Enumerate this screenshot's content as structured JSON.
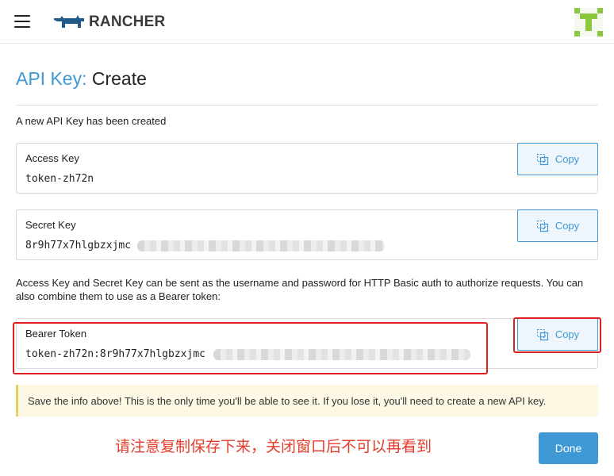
{
  "header": {
    "logo_text": "RANCHER",
    "brand_color": "#1f5a8a",
    "accent_color": "#3d98d3"
  },
  "page": {
    "title_prefix": "API Key:",
    "title_suffix": "Create",
    "notice": "A new API Key has been created",
    "explain": "Access Key and Secret Key can be sent as the username and password for HTTP Basic auth to authorize requests. You can also combine them to use as a Bearer token:",
    "warning": "Save the info above! This is the only time you'll be able to see it. If you lose it, you'll need to create a new API key.",
    "annotation": "请注意复制保存下来，关闭窗口后不可以再看到",
    "done_label": "Done"
  },
  "keys": {
    "access": {
      "label": "Access Key",
      "value": "token-zh72n",
      "copy_label": "Copy"
    },
    "secret": {
      "label": "Secret Key",
      "value": "8r9h77x7hlgbzxjmc",
      "copy_label": "Copy"
    },
    "bearer": {
      "label": "Bearer Token",
      "value": "token-zh72n:8r9h77x7hlgbzxjmc",
      "copy_label": "Copy"
    }
  },
  "icons": {
    "menu": "hamburger-menu-icon",
    "logo": "rancher-cow-logo",
    "avatar": "user-identicon",
    "copy": "copy-clipboard-icon"
  },
  "colors": {
    "highlight_box": "#e02020",
    "warning_bg": "#fcf8e3",
    "annotation_text": "#e53c2a"
  }
}
